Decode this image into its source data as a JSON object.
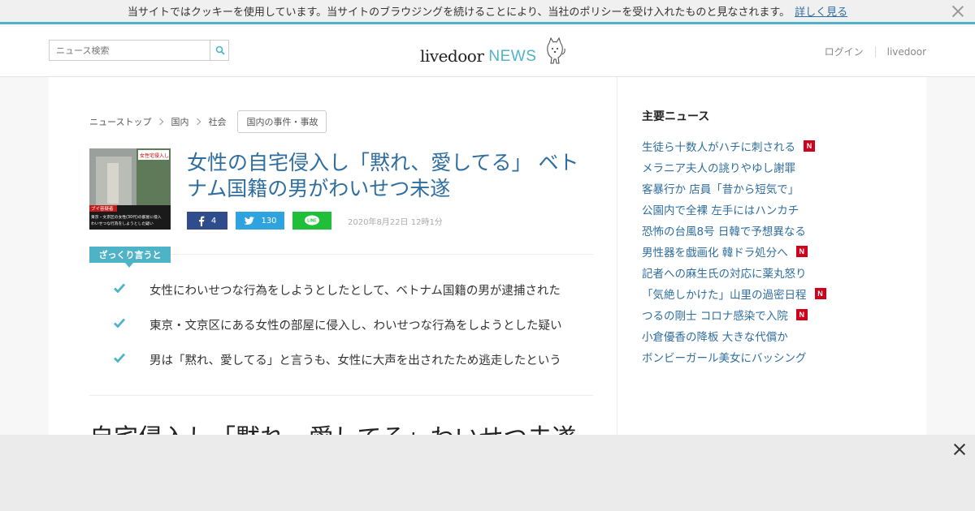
{
  "cookie_bar": {
    "message": "当サイトではクッキーを使用しています。当サイトのブラウジングを続けることにより、当社のポリシーを受け入れたものと見なされます。",
    "link_label": "詳しく見る"
  },
  "header": {
    "search_placeholder": "ニュース検索",
    "logo_main": "livedoor",
    "logo_sub": "NEWS",
    "nav": [
      "ログイン",
      "livedoor"
    ]
  },
  "breadcrumb": {
    "items": [
      "ニューストップ",
      "国内",
      "社会"
    ],
    "tag": "国内の事件・事故"
  },
  "article": {
    "headline": "女性の自宅侵入し「黙れ、愛してる」 ベトナム国籍の男がわいせつ未遂",
    "share": {
      "facebook_count": "4",
      "twitter_count": "130",
      "line_label": "LINE"
    },
    "date": "2020年8月22日 12時1分",
    "summary_label": "ざっくり言うと",
    "summary": [
      "女性にわいせつな行為をしようとしたとして、ベトナム国籍の男が逮捕された",
      "東京・文京区にある女性の部屋に侵入し、わいせつな行為をしようとした疑い",
      "男は「黙れ、愛してる」と言うも、女性に大声を出されたため逃走したという"
    ],
    "title_partial": "自宅侵入し「黙れ、愛してる」わいせつ未遂",
    "thumb_caption_top": "女性宅侵入し",
    "thumb_caption_lines": [
      "ブイ容疑者",
      "東京・文京区の女性(30代)の部屋に侵入",
      "わいせつな行為をしようとした疑い"
    ]
  },
  "sidebar": {
    "heading": "主要ニュース",
    "new_badge": "N",
    "items": [
      {
        "label": "生徒ら十数人がハチに刺される",
        "new": true
      },
      {
        "label": "メラニア夫人の誂りやゆし謝罪",
        "new": false
      },
      {
        "label": "客暴行か 店員「昔から短気で」",
        "new": false
      },
      {
        "label": "公園内で全裸 左手にはハンカチ",
        "new": false
      },
      {
        "label": "恐怖の台風8号 日韓で予想異なる",
        "new": false
      },
      {
        "label": "男性器を戯画化 韓ドラ処分へ",
        "new": true
      },
      {
        "label": "記者への麻生氏の対応に薬丸怒り",
        "new": false
      },
      {
        "label": "「気絶しかけた」山里の過密日程",
        "new": true
      },
      {
        "label": "つるの剛士 コロナ感染で入院",
        "new": true
      },
      {
        "label": "小倉優香の降板 大きな代償か",
        "new": false
      },
      {
        "label": "ボンビーガール美女にバッシング",
        "new": false
      }
    ]
  },
  "colors": {
    "accent": "#4fb3c8",
    "link": "#2f6e9f",
    "facebook": "#2f4d8a",
    "twitter": "#2fa3df",
    "line": "#1fbf3a",
    "new_badge": "#d0021b"
  }
}
